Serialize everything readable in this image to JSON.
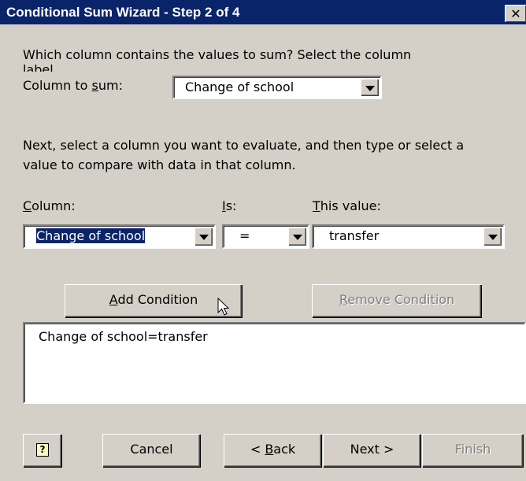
{
  "window": {
    "title": "Conditional Sum Wizard - Step 2 of 4",
    "close_glyph": "✕"
  },
  "prompt1_line1": "Which column contains the values to sum? Select the column",
  "prompt1_line2": "label",
  "column_to_sum": {
    "label_pre": "Column to ",
    "label_hot": "s",
    "label_post": "um:",
    "value": "Change of school"
  },
  "prompt2_line1": "Next, select a column you want to evaluate, and then type or select a",
  "prompt2_line2": "value to compare with data in that column.",
  "column": {
    "label_hot": "C",
    "label_post": "olumn:",
    "value": "Change of school"
  },
  "is": {
    "label_hot": "I",
    "label_post": "s:",
    "value": "="
  },
  "this_value": {
    "label_hot": "T",
    "label_post": "his value:",
    "value": "transfer"
  },
  "buttons": {
    "add_hot": "A",
    "add_post": "dd Condition",
    "remove_hot": "R",
    "remove_post": "emove Condition",
    "help_glyph": "?",
    "cancel": "Cancel",
    "back_pre": "< ",
    "back_hot": "B",
    "back_post": "ack",
    "next": "Next >",
    "finish": "Finish"
  },
  "conditions": [
    "Change of school=transfer"
  ],
  "icons": {
    "close": "close-icon",
    "help": "help-icon",
    "cursor": "mouse-pointer-icon",
    "dropdown": "chevron-down-icon"
  }
}
